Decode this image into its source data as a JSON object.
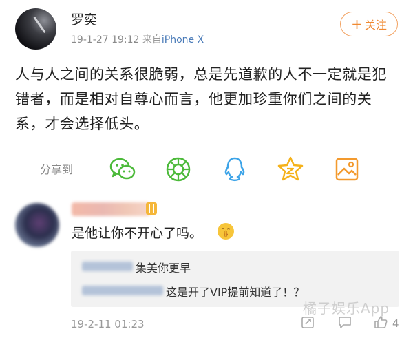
{
  "post": {
    "username": "罗奕",
    "date": "19-1-27 19:12",
    "source_prefix": "来自",
    "device": "iPhone X",
    "follow_label": "关注",
    "text": "人与人之间的关系很脆弱，总是先道歉的人不一定就是犯错者，而是相对自尊心而言，他更加珍重你们之间的关系，才会选择低头。"
  },
  "share": {
    "label": "分享到",
    "icons": [
      "wechat-icon",
      "moments-icon",
      "qq-icon",
      "qzone-icon",
      "weibo-album-icon"
    ]
  },
  "comment": {
    "text": "是他让你不开心了吗。",
    "emoji": "shush-emoji",
    "replies": [
      {
        "text": "集美你更早"
      },
      {
        "text": "这是开了VIP提前知道了！？"
      }
    ],
    "timestamp": "19-2-11 01:23",
    "like_count": "4"
  },
  "watermark": "橘子娱乐App",
  "colors": {
    "accent": "#f08a32",
    "share_green": "#4cba3a",
    "share_blue": "#3da4e8",
    "share_yellow": "#f5b21b",
    "share_orange": "#f39a2e"
  }
}
